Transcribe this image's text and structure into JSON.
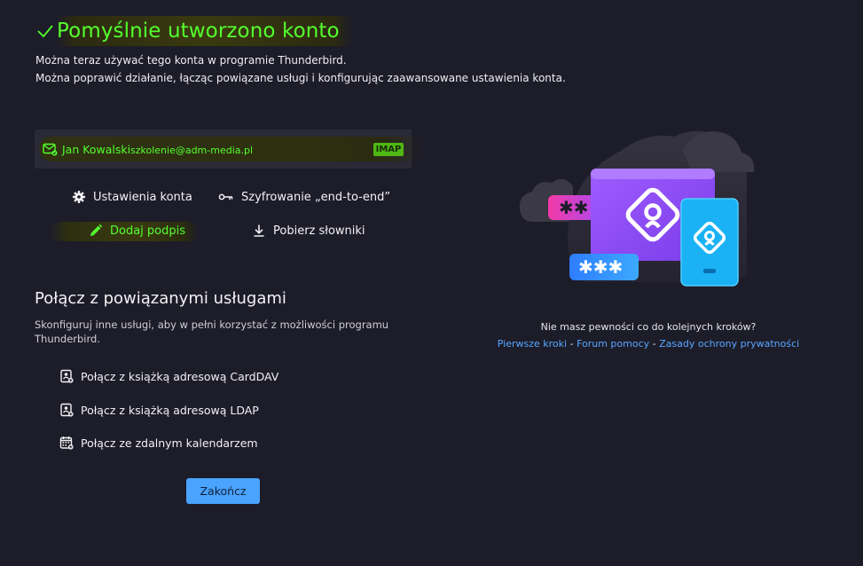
{
  "header": {
    "title": "Pomyślnie utworzono konto",
    "line1": "Można teraz używać tego konta w programie Thunderbird.",
    "line2": "Można poprawić działanie, łącząc powiązane usługi i konfigurując zaawansowane ustawienia konta."
  },
  "account": {
    "name": "Jan Kowalski",
    "email": "szkolenie@adm-media.pl",
    "badge": "IMAP"
  },
  "actions": {
    "settings": "Ustawienia konta",
    "e2e": "Szyfrowanie „end-to-end”",
    "signature": "Dodaj podpis",
    "dictionaries": "Pobierz słowniki"
  },
  "services": {
    "title": "Połącz z powiązanymi usługami",
    "description": "Skonfiguruj inne usługi, aby w pełni korzystać z możliwości programu Thunderbird.",
    "items": [
      {
        "label": "Połącz z książką adresową CardDAV",
        "icon": "address-book-icon"
      },
      {
        "label": "Połącz z książką adresową LDAP",
        "icon": "address-book-icon"
      },
      {
        "label": "Połącz ze zdalnym kalendarzem",
        "icon": "calendar-icon"
      }
    ]
  },
  "finish_label": "Zakończ",
  "help": {
    "question": "Nie masz pewności co do kolejnych kroków?",
    "link1": "Pierwsze kroki",
    "link2": "Forum pomocy",
    "link3": "Zasady ochrony prywatności",
    "separator": " - "
  },
  "colors": {
    "background": "#1d1c29",
    "highlight_green": "#54ff2e",
    "accent_blue": "#4aa3ff",
    "badge_green": "#4fb814"
  }
}
